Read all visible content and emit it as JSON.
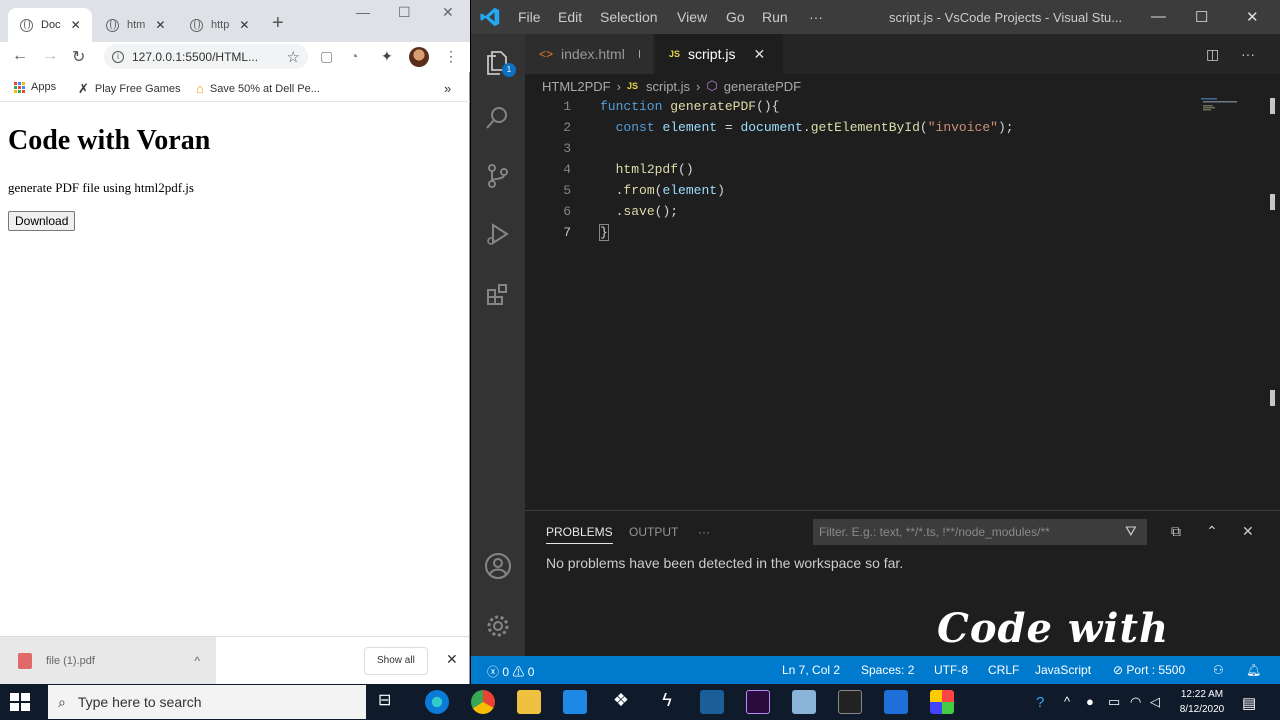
{
  "chrome": {
    "tabs": [
      {
        "title": "Doc",
        "close": "✕"
      },
      {
        "title": "htm",
        "close": "✕"
      },
      {
        "title": "http",
        "close": "✕"
      }
    ],
    "new_tab": "+",
    "url": "127.0.0.1:5500/HTML...",
    "bookmarks": [
      "Apps",
      "Play Free Games",
      "Save 50% at Dell Pe..."
    ],
    "bookmarks_more": "»",
    "page": {
      "heading": "Code with Voran",
      "paragraph": "generate PDF file using html2pdf.js",
      "button": "Download"
    },
    "download": {
      "file": "file (1).pdf",
      "show_all": "Show all",
      "close": "✕"
    }
  },
  "vscode": {
    "menu": [
      "File",
      "Edit",
      "Selection",
      "View",
      "Go",
      "Run",
      "···"
    ],
    "title": "script.js - VsCode Projects - Visual Stu...",
    "explorer_badge": "1",
    "tabs": [
      {
        "label": "index.html",
        "icon": "<>"
      },
      {
        "label": "script.js",
        "icon": "JS",
        "close": "✕"
      }
    ],
    "breadcrumb": [
      "HTML2PDF",
      "script.js",
      "generatePDF"
    ],
    "code_lines": [
      "1",
      "2",
      "3",
      "4",
      "5",
      "6",
      "7"
    ],
    "code": {
      "l1_kw": "function",
      "l1_fn": "generatePDF",
      "l1_rest": "(){",
      "l2_kw": "const",
      "l2_var": "element",
      "l2_eq": " = ",
      "l2_obj": "document",
      "l2_dot": ".",
      "l2_fn": "getElementById",
      "l2_open": "(",
      "l2_str": "\"invoice\"",
      "l2_close": ");",
      "l4_fn": "html2pdf",
      "l4_rest": "()",
      "l5_dot": ".",
      "l5_fn": "from",
      "l5_open": "(",
      "l5_var": "element",
      "l5_close": ")",
      "l6_dot": ".",
      "l6_fn": "save",
      "l6_rest": "();",
      "l7": "}"
    },
    "panel": {
      "tabs": [
        "PROBLEMS",
        "OUTPUT",
        "···"
      ],
      "filter_placeholder": "Filter. E.g.: text, **/*.ts, !**/node_modules/**",
      "message": "No problems have been detected in the workspace so far."
    },
    "watermark": "Code with Voran",
    "status": {
      "errors": "0",
      "warnings": "0",
      "position": "Ln 7, Col 2",
      "spaces": "Spaces: 2",
      "encoding": "UTF-8",
      "eol": "CRLF",
      "language": "JavaScript",
      "port": "Port : 5500"
    }
  },
  "taskbar": {
    "search_placeholder": "Type here to search",
    "time": "12:22 AM",
    "date": "8/12/2020"
  }
}
